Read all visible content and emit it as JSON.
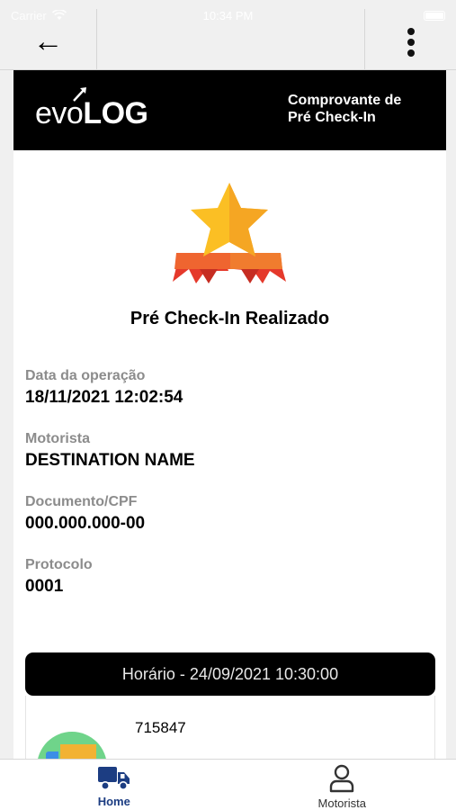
{
  "status_bar": {
    "carrier": "Carrier",
    "time": "10:34 PM"
  },
  "nav": {
    "back_icon": "arrow-left-icon",
    "menu_icon": "more-vertical-icon"
  },
  "header": {
    "logo_prefix": "evo",
    "logo_suffix": "LOG",
    "receipt_title": "Comprovante de Pré Check-In"
  },
  "status": {
    "title": "Pré Check-In Realizado",
    "icon": "star-ribbon-badge-icon",
    "colors": {
      "star": "#fbbf24",
      "ribbon": "#e94b2e"
    }
  },
  "fields": [
    {
      "label": "Data da operação",
      "value": "18/11/2021 12:02:54"
    },
    {
      "label": "Motorista",
      "value": "DESTINATION NAME"
    },
    {
      "label": "Documento/CPF",
      "value": "000.000.000-00"
    },
    {
      "label": "Protocolo",
      "value": "0001"
    }
  ],
  "schedule": {
    "header": "Horário - 24/09/2021 10:30:00",
    "items": [
      {
        "number": "715847",
        "icon": "truck-avatar-icon"
      }
    ]
  },
  "tab_bar": {
    "tabs": [
      {
        "label": "Home",
        "icon": "truck-icon",
        "active": true,
        "color": "#1c3d82"
      },
      {
        "label": "Motorista",
        "icon": "user-icon",
        "active": false,
        "color": "#333333"
      }
    ]
  }
}
